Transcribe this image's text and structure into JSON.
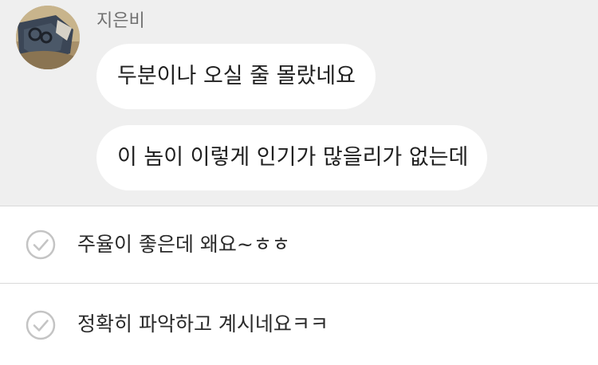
{
  "chat": {
    "sender": {
      "name": "지은비",
      "avatar_icon": "profile-photo-avatar"
    },
    "messages": [
      {
        "text": "두분이나 오실 줄 몰랐네요"
      },
      {
        "text": "이 놈이 이렇게 인기가 많을리가 없는데"
      }
    ]
  },
  "options": [
    {
      "label": "주율이 좋은데 왜요~ㅎㅎ",
      "icon": "check-circle-icon"
    },
    {
      "label": "정확히 파악하고 계시네요ㅋㅋ",
      "icon": "check-circle-icon"
    }
  ],
  "colors": {
    "chat_background": "#efefef",
    "bubble": "#ffffff",
    "divider": "#d9d9d9",
    "check_icon": "#c4c4c4"
  }
}
